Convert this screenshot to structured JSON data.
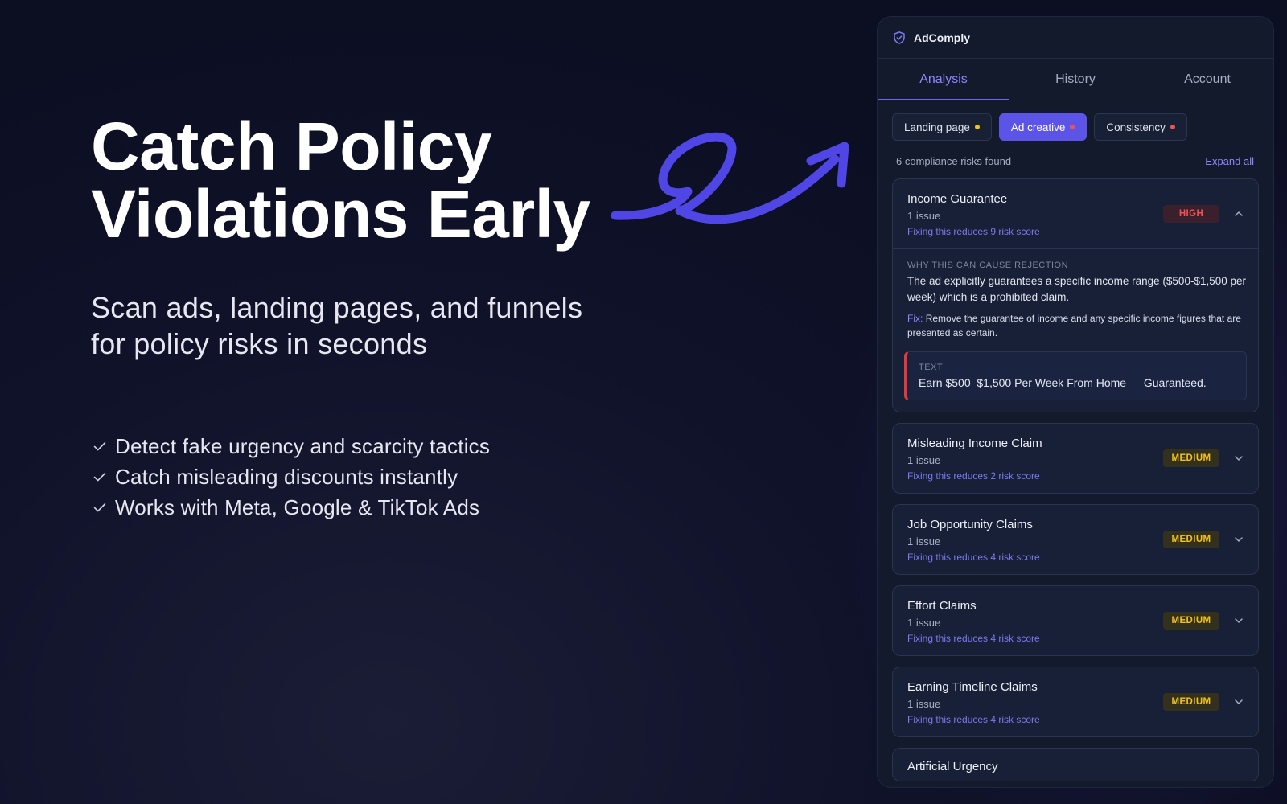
{
  "hero": {
    "headline_line1": "Catch Policy",
    "headline_line2": "Violations Early",
    "subhead": "Scan ads, landing pages, and funnels for policy risks in seconds",
    "features": [
      "Detect fake urgency and scarcity tactics",
      "Catch misleading discounts instantly",
      "Works with Meta, Google & TikTok Ads"
    ],
    "accent_color": "#4f46e5"
  },
  "panel": {
    "brand": "AdComply",
    "tabs": [
      {
        "label": "Analysis",
        "active": true
      },
      {
        "label": "History",
        "active": false
      },
      {
        "label": "Account",
        "active": false
      }
    ],
    "chips": [
      {
        "label": "Landing page",
        "dot_color": "#f2c21b",
        "active": false
      },
      {
        "label": "Ad creative",
        "dot_color": "#f05252",
        "active": true
      },
      {
        "label": "Consistency",
        "dot_color": "#f05252",
        "active": false
      }
    ],
    "summary": {
      "count_text": "6 compliance risks found",
      "expand_label": "Expand all"
    },
    "risks": [
      {
        "title": "Income Guarantee",
        "issues": "1 issue",
        "fix_note": "Fixing this reduces 9 risk score",
        "severity": "HIGH",
        "expanded": true,
        "why_label": "WHY THIS CAN CAUSE REJECTION",
        "why_text": "The ad explicitly guarantees a specific income range ($500-$1,500 per week) which is a prohibited claim.",
        "fix_key": "Fix:",
        "fix_text": "Remove the guarantee of income and any specific income figures that are presented as certain.",
        "evidence_label": "TEXT",
        "evidence_text": "Earn $500–$1,500 Per Week From Home — Guaranteed."
      },
      {
        "title": "Misleading Income Claim",
        "issues": "1 issue",
        "fix_note": "Fixing this reduces 2 risk score",
        "severity": "MEDIUM"
      },
      {
        "title": "Job Opportunity Claims",
        "issues": "1 issue",
        "fix_note": "Fixing this reduces 4 risk score",
        "severity": "MEDIUM"
      },
      {
        "title": "Effort Claims",
        "issues": "1 issue",
        "fix_note": "Fixing this reduces 4 risk score",
        "severity": "MEDIUM"
      },
      {
        "title": "Earning Timeline Claims",
        "issues": "1 issue",
        "fix_note": "Fixing this reduces 4 risk score",
        "severity": "MEDIUM"
      },
      {
        "title": "Artificial Urgency"
      }
    ]
  }
}
